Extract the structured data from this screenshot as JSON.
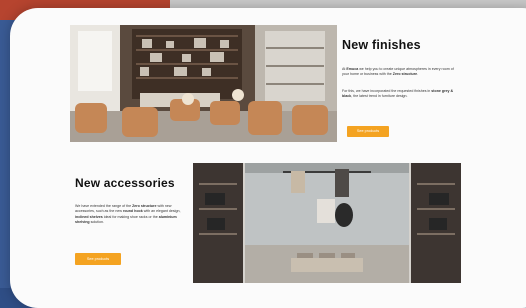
{
  "finishes": {
    "title": "New finishes",
    "p1_a": "At ",
    "p1_brand": "Emuca",
    "p1_b": " we help you to create unique atmospheres in every room of your home or business with the ",
    "p1_product": "Zero structure",
    "p1_c": ".",
    "p2_a": "For this, we have incorporated the requested finishes in ",
    "p2_colors": "stone grey & black",
    "p2_b": ", the latest trend in furniture design.",
    "button_label": "See products"
  },
  "accessories": {
    "title": "New accessories",
    "p_a": "We have extended the range of the ",
    "p_product": "Zero structure",
    "p_b": " with new accessories, such as the new ",
    "p_bar": "round hook",
    "p_c": " with an elegant design, ",
    "p_shelves": "inclined shelves",
    "p_d": " ideal for making shoe racks or the ",
    "p_system": "aluminium shelving",
    "p_e": " solution.",
    "button_label": "See products"
  },
  "colors": {
    "accent": "#f4a321",
    "page_background": "#fbfbfb",
    "outer_background": "#2f4e86"
  }
}
